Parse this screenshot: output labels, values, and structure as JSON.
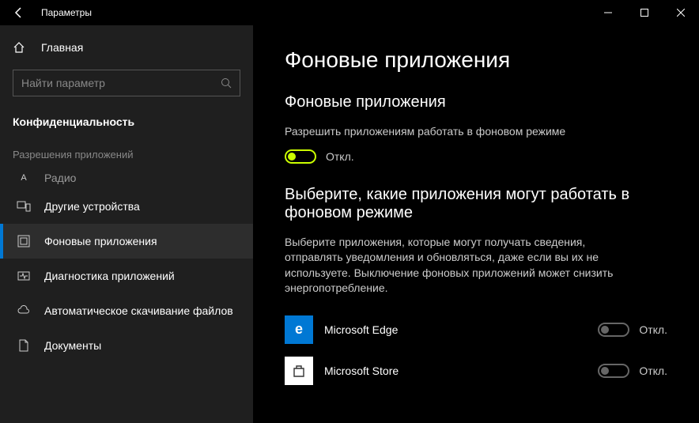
{
  "window": {
    "title": "Параметры"
  },
  "sidebar": {
    "home": "Главная",
    "search_placeholder": "Найти параметр",
    "section": "Конфиденциальность",
    "subhead": "Разрешения приложений",
    "items": [
      {
        "label": "Радио"
      },
      {
        "label": "Другие устройства"
      },
      {
        "label": "Фоновые приложения"
      },
      {
        "label": "Диагностика приложений"
      },
      {
        "label": "Автоматическое скачивание файлов"
      },
      {
        "label": "Документы"
      }
    ]
  },
  "main": {
    "title": "Фоновые приложения",
    "section1_heading": "Фоновые приложения",
    "section1_desc": "Разрешить приложениям работать в фоновом режиме",
    "master_toggle_state": "Откл.",
    "section2_heading": "Выберите, какие приложения могут работать в фоновом режиме",
    "section2_desc": "Выберите приложения, которые могут получать сведения, отправлять уведомления и обновляться, даже если вы их не используете. Выключение фоновых приложений может снизить энергопотребление.",
    "apps": [
      {
        "name": "Microsoft Edge",
        "state": "Откл."
      },
      {
        "name": "Microsoft Store",
        "state": "Откл."
      }
    ]
  }
}
